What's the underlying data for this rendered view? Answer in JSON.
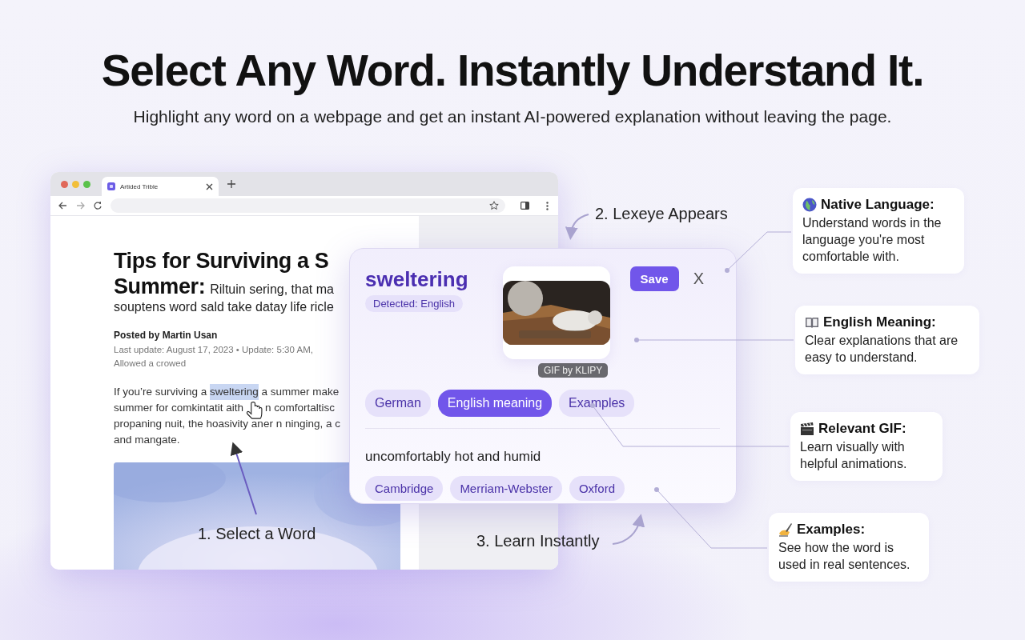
{
  "headline": "Select Any Word. Instantly Understand It.",
  "subheadline": "Highlight any word on a webpage and get an instant AI-powered explanation without leaving the page.",
  "browser": {
    "tab_title": "Artided Trible",
    "article": {
      "title": "Tips for Surviving a S",
      "title_line2": "Summer:",
      "title_tail": "Riltuin sering, that ma",
      "title_line3": "souptens word sald take datay life ricle",
      "byline": "Posted by Martin Usan",
      "meta": "Last update: August 17, 2023  •  Update: 5:30 AM,",
      "meta_line2": "Allowed a crowed",
      "paragraph": [
        [
          {
            "text": "If you’re surviving a ",
            "highlighted": false
          },
          {
            "text": "sweltering",
            "highlighted": true
          },
          {
            "text": " a summer make",
            "highlighted": false
          }
        ],
        [
          {
            "text": "summer for comkintatit aith",
            "highlighted": false
          },
          {
            "text": "n comfortaltisc",
            "highlighted": false
          }
        ],
        [
          {
            "text": "propaning nuit, the hoasivity aner n ninging, a c",
            "highlighted": false
          }
        ],
        [
          {
            "text": "and mangate.",
            "highlighted": false
          }
        ]
      ]
    }
  },
  "popup": {
    "word": "sweltering",
    "detected": "Detected: English",
    "save": "Save",
    "close": "X",
    "gif_credit": "GIF by KLIPY",
    "tabs": [
      {
        "label": "German",
        "selected": false
      },
      {
        "label": "English meaning",
        "selected": true
      },
      {
        "label": "Examples",
        "selected": false
      }
    ],
    "definition": "uncomfortably hot and humid",
    "sources": [
      "Cambridge",
      "Merriam-Webster",
      "Oxford"
    ]
  },
  "steps": [
    "1. Select a Word",
    "2. Lexeye Appears",
    "3. Learn Instantly"
  ],
  "features": [
    {
      "kind": "globe",
      "title": "Native Language:",
      "text": "Understand words in the language you're most comfortable with."
    },
    {
      "kind": "book",
      "title": "English Meaning:",
      "text": "Clear explanations that are easy to understand."
    },
    {
      "kind": "clapper",
      "title": "Relevant GIF:",
      "text": "Learn visually with helpful animations."
    },
    {
      "kind": "writing",
      "title": "Examples:",
      "text": "See how the word is used in real sentences."
    }
  ]
}
